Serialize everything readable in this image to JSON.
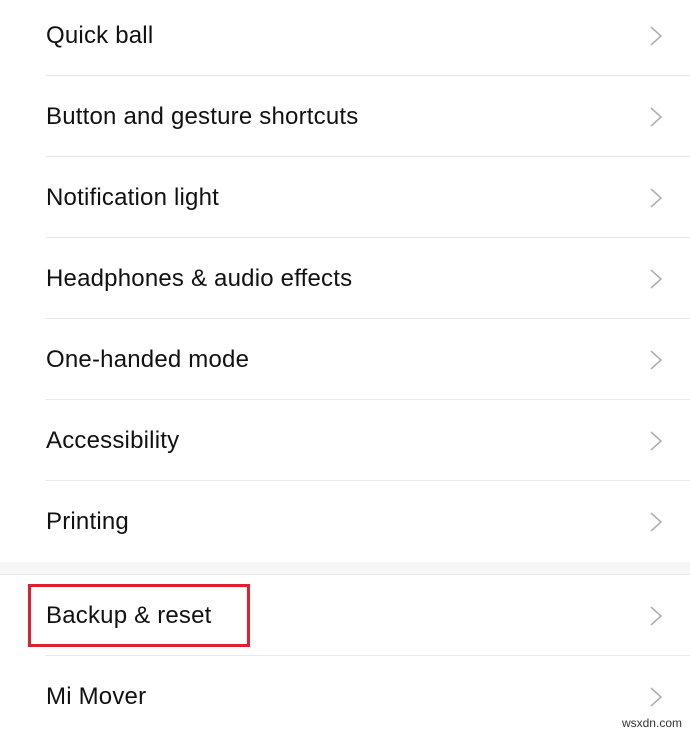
{
  "group1": [
    {
      "label": "Quick ball",
      "icon": "chevron-right-icon"
    },
    {
      "label": "Button and gesture shortcuts",
      "icon": "chevron-right-icon"
    },
    {
      "label": "Notification light",
      "icon": "chevron-right-icon"
    },
    {
      "label": "Headphones & audio effects",
      "icon": "chevron-right-icon"
    },
    {
      "label": "One-handed mode",
      "icon": "chevron-right-icon"
    },
    {
      "label": "Accessibility",
      "icon": "chevron-right-icon"
    },
    {
      "label": "Printing",
      "icon": "chevron-right-icon"
    }
  ],
  "group2": [
    {
      "label": "Backup & reset",
      "icon": "chevron-right-icon",
      "highlighted": true
    },
    {
      "label": "Mi Mover",
      "icon": "chevron-right-icon"
    }
  ],
  "highlight_color": "#e02030",
  "watermark": "wsxdn.com"
}
